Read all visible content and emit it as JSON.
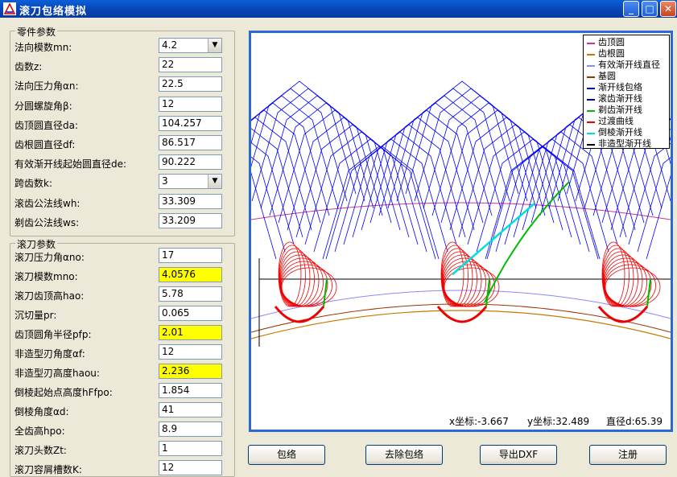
{
  "window": {
    "title": "滚刀包络模拟",
    "minimize": "_",
    "maximize": "□",
    "close": "✕"
  },
  "part_params": {
    "title": "零件参数",
    "rows": [
      {
        "label": "法向模数mn:",
        "value": "4.2",
        "combo": true
      },
      {
        "label": "齿数z:",
        "value": "22"
      },
      {
        "label": "法向压力角αn:",
        "value": "22.5"
      },
      {
        "label": "分圆螺旋角β:",
        "value": "12"
      },
      {
        "label": "齿顶圆直径da:",
        "value": "104.257"
      },
      {
        "label": "齿根圆直径df:",
        "value": "86.517"
      },
      {
        "label": "有效渐开线起始圆直径de:",
        "value": "90.222"
      },
      {
        "label": "跨齿数k:",
        "value": "3",
        "combo": true
      },
      {
        "label": "滚齿公法线wh:",
        "value": "33.309"
      },
      {
        "label": "剃齿公法线ws:",
        "value": "33.209"
      }
    ]
  },
  "hob_params": {
    "title": "滚刀参数",
    "rows": [
      {
        "label": "滚刀压力角αno:",
        "value": "17"
      },
      {
        "label": "滚刀模数mno:",
        "value": "4.0576",
        "highlight": true
      },
      {
        "label": "滚刀齿顶高hao:",
        "value": "5.78"
      },
      {
        "label": "沉切量pr:",
        "value": "0.065"
      },
      {
        "label": "齿顶圆角半径pfp:",
        "value": "2.01",
        "highlight": true
      },
      {
        "label": "非造型刃角度αf:",
        "value": "12"
      },
      {
        "label": "非造型刃高度haou:",
        "value": "2.236",
        "highlight": true
      },
      {
        "label": "倒棱起始点高度hFfpo:",
        "value": "1.854"
      },
      {
        "label": "倒棱角度αd:",
        "value": "41"
      },
      {
        "label": "全齿高hpo:",
        "value": "8.9"
      },
      {
        "label": "滚刀头数Zt:",
        "value": "1"
      },
      {
        "label": "滚刀容屑槽数K:",
        "value": "12"
      }
    ]
  },
  "legend": [
    {
      "label": "齿顶圆",
      "color": "#cc3399"
    },
    {
      "label": "齿根圆",
      "color": "#c87800"
    },
    {
      "label": "有效渐开线直径",
      "color": "#8888ff"
    },
    {
      "label": "基圆",
      "color": "#993300"
    },
    {
      "label": "渐开线包络",
      "color": "#0000ff"
    },
    {
      "label": "滚齿渐开线",
      "color": "#0000aa"
    },
    {
      "label": "剃齿渐开线",
      "color": "#00bb00"
    },
    {
      "label": "过渡曲线",
      "color": "#ee0000"
    },
    {
      "label": "倒棱渐开线",
      "color": "#00dddd"
    },
    {
      "label": "非造型渐开线",
      "color": "#000000"
    }
  ],
  "readout": {
    "x": "x坐标:-3.667",
    "y": "y坐标:32.489",
    "d": "直径d:65.39"
  },
  "buttons": {
    "envelope": "包络",
    "remove_envelope": "去除包络",
    "export_dxf": "导出DXF",
    "register": "注册"
  }
}
